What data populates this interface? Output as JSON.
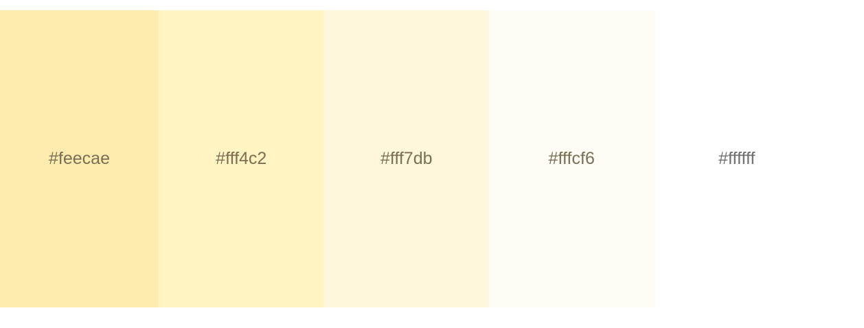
{
  "palette": {
    "swatches": [
      {
        "color": "#feecae",
        "label": "#feecae"
      },
      {
        "color": "#fff4c2",
        "label": "#fff4c2"
      },
      {
        "color": "#fff7db",
        "label": "#fff7db"
      },
      {
        "color": "#fffcf6",
        "label": "#fffcf6"
      },
      {
        "color": "#ffffff",
        "label": "#ffffff"
      }
    ]
  }
}
